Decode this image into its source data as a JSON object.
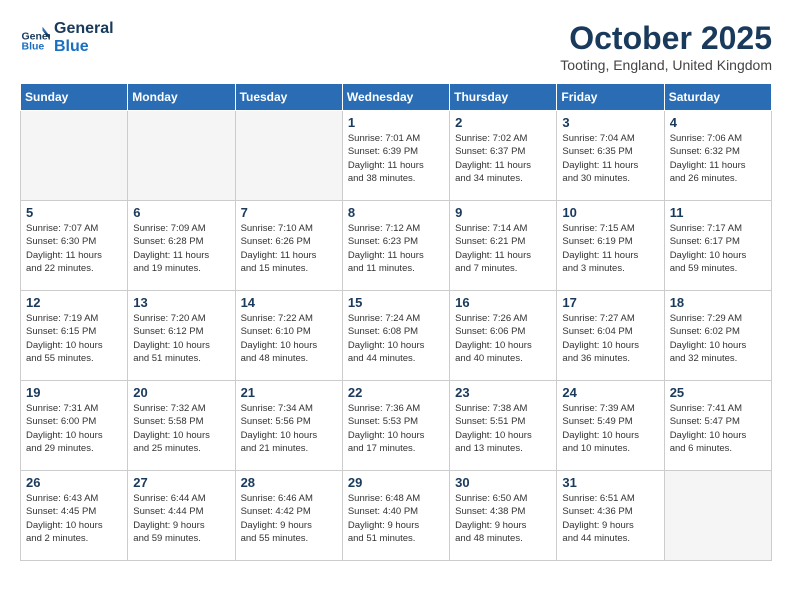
{
  "header": {
    "logo_line1": "General",
    "logo_line2": "Blue",
    "month": "October 2025",
    "location": "Tooting, England, United Kingdom"
  },
  "days_of_week": [
    "Sunday",
    "Monday",
    "Tuesday",
    "Wednesday",
    "Thursday",
    "Friday",
    "Saturday"
  ],
  "weeks": [
    [
      {
        "day": "",
        "info": ""
      },
      {
        "day": "",
        "info": ""
      },
      {
        "day": "",
        "info": ""
      },
      {
        "day": "1",
        "info": "Sunrise: 7:01 AM\nSunset: 6:39 PM\nDaylight: 11 hours\nand 38 minutes."
      },
      {
        "day": "2",
        "info": "Sunrise: 7:02 AM\nSunset: 6:37 PM\nDaylight: 11 hours\nand 34 minutes."
      },
      {
        "day": "3",
        "info": "Sunrise: 7:04 AM\nSunset: 6:35 PM\nDaylight: 11 hours\nand 30 minutes."
      },
      {
        "day": "4",
        "info": "Sunrise: 7:06 AM\nSunset: 6:32 PM\nDaylight: 11 hours\nand 26 minutes."
      }
    ],
    [
      {
        "day": "5",
        "info": "Sunrise: 7:07 AM\nSunset: 6:30 PM\nDaylight: 11 hours\nand 22 minutes."
      },
      {
        "day": "6",
        "info": "Sunrise: 7:09 AM\nSunset: 6:28 PM\nDaylight: 11 hours\nand 19 minutes."
      },
      {
        "day": "7",
        "info": "Sunrise: 7:10 AM\nSunset: 6:26 PM\nDaylight: 11 hours\nand 15 minutes."
      },
      {
        "day": "8",
        "info": "Sunrise: 7:12 AM\nSunset: 6:23 PM\nDaylight: 11 hours\nand 11 minutes."
      },
      {
        "day": "9",
        "info": "Sunrise: 7:14 AM\nSunset: 6:21 PM\nDaylight: 11 hours\nand 7 minutes."
      },
      {
        "day": "10",
        "info": "Sunrise: 7:15 AM\nSunset: 6:19 PM\nDaylight: 11 hours\nand 3 minutes."
      },
      {
        "day": "11",
        "info": "Sunrise: 7:17 AM\nSunset: 6:17 PM\nDaylight: 10 hours\nand 59 minutes."
      }
    ],
    [
      {
        "day": "12",
        "info": "Sunrise: 7:19 AM\nSunset: 6:15 PM\nDaylight: 10 hours\nand 55 minutes."
      },
      {
        "day": "13",
        "info": "Sunrise: 7:20 AM\nSunset: 6:12 PM\nDaylight: 10 hours\nand 51 minutes."
      },
      {
        "day": "14",
        "info": "Sunrise: 7:22 AM\nSunset: 6:10 PM\nDaylight: 10 hours\nand 48 minutes."
      },
      {
        "day": "15",
        "info": "Sunrise: 7:24 AM\nSunset: 6:08 PM\nDaylight: 10 hours\nand 44 minutes."
      },
      {
        "day": "16",
        "info": "Sunrise: 7:26 AM\nSunset: 6:06 PM\nDaylight: 10 hours\nand 40 minutes."
      },
      {
        "day": "17",
        "info": "Sunrise: 7:27 AM\nSunset: 6:04 PM\nDaylight: 10 hours\nand 36 minutes."
      },
      {
        "day": "18",
        "info": "Sunrise: 7:29 AM\nSunset: 6:02 PM\nDaylight: 10 hours\nand 32 minutes."
      }
    ],
    [
      {
        "day": "19",
        "info": "Sunrise: 7:31 AM\nSunset: 6:00 PM\nDaylight: 10 hours\nand 29 minutes."
      },
      {
        "day": "20",
        "info": "Sunrise: 7:32 AM\nSunset: 5:58 PM\nDaylight: 10 hours\nand 25 minutes."
      },
      {
        "day": "21",
        "info": "Sunrise: 7:34 AM\nSunset: 5:56 PM\nDaylight: 10 hours\nand 21 minutes."
      },
      {
        "day": "22",
        "info": "Sunrise: 7:36 AM\nSunset: 5:53 PM\nDaylight: 10 hours\nand 17 minutes."
      },
      {
        "day": "23",
        "info": "Sunrise: 7:38 AM\nSunset: 5:51 PM\nDaylight: 10 hours\nand 13 minutes."
      },
      {
        "day": "24",
        "info": "Sunrise: 7:39 AM\nSunset: 5:49 PM\nDaylight: 10 hours\nand 10 minutes."
      },
      {
        "day": "25",
        "info": "Sunrise: 7:41 AM\nSunset: 5:47 PM\nDaylight: 10 hours\nand 6 minutes."
      }
    ],
    [
      {
        "day": "26",
        "info": "Sunrise: 6:43 AM\nSunset: 4:45 PM\nDaylight: 10 hours\nand 2 minutes."
      },
      {
        "day": "27",
        "info": "Sunrise: 6:44 AM\nSunset: 4:44 PM\nDaylight: 9 hours\nand 59 minutes."
      },
      {
        "day": "28",
        "info": "Sunrise: 6:46 AM\nSunset: 4:42 PM\nDaylight: 9 hours\nand 55 minutes."
      },
      {
        "day": "29",
        "info": "Sunrise: 6:48 AM\nSunset: 4:40 PM\nDaylight: 9 hours\nand 51 minutes."
      },
      {
        "day": "30",
        "info": "Sunrise: 6:50 AM\nSunset: 4:38 PM\nDaylight: 9 hours\nand 48 minutes."
      },
      {
        "day": "31",
        "info": "Sunrise: 6:51 AM\nSunset: 4:36 PM\nDaylight: 9 hours\nand 44 minutes."
      },
      {
        "day": "",
        "info": ""
      }
    ]
  ]
}
